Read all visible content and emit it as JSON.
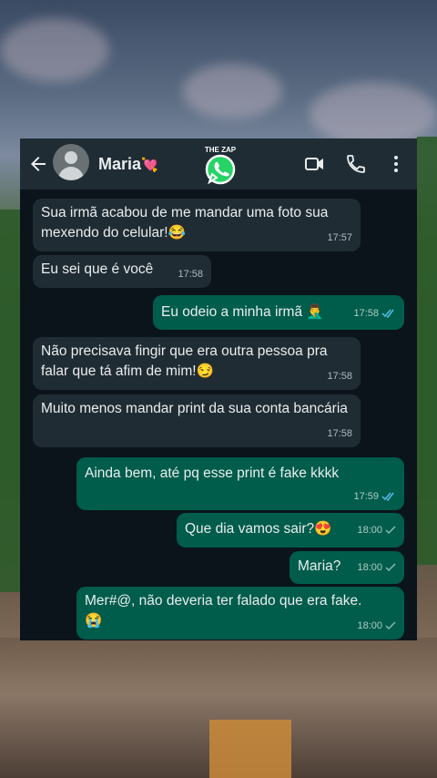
{
  "header": {
    "back_icon": "arrow-left-icon",
    "contact_name": "Maria",
    "heart_emoji": "💘",
    "logo_text": "THE ZAP",
    "icons": [
      "video-call-icon",
      "phone-icon",
      "more-vertical-icon"
    ]
  },
  "messages": [
    {
      "direction": "in",
      "text": "Sua irmã acabou de me mandar uma foto sua mexendo do celular!",
      "emoji": "😂",
      "time": "17:57"
    },
    {
      "direction": "in",
      "text": "Eu sei que é você",
      "time": "17:58"
    },
    {
      "direction": "out",
      "text": "Eu odeio a minha irmã",
      "emoji": "🤦‍♂️",
      "time": "17:58",
      "status": "read"
    },
    {
      "direction": "in",
      "text": "Não precisava fingir que era outra pessoa pra falar que tá afim de mim!",
      "emoji": "😏",
      "time": "17:58"
    },
    {
      "direction": "in",
      "text": "Muito menos mandar print da sua conta bancária",
      "time": "17:58"
    },
    {
      "direction": "out",
      "text": "Ainda bem, até pq esse print é fake kkkk",
      "time": "17:59",
      "status": "read"
    },
    {
      "direction": "out",
      "text": "Que dia vamos sair?",
      "emoji": "😍",
      "time": "18:00",
      "status": "sent"
    },
    {
      "direction": "out",
      "text": "Maria?",
      "time": "18:00",
      "status": "sent"
    },
    {
      "direction": "out",
      "text": "Mer#@, não deveria ter falado que era fake.",
      "emoji": "😭",
      "time": "18:00",
      "status": "sent"
    }
  ],
  "colors": {
    "header_bg": "#1f2c34",
    "chat_bg": "#0b141a",
    "incoming_bubble": "#202c33",
    "outgoing_bubble": "#005c4b",
    "read_tick": "#53bdeb",
    "sent_tick": "#8bb9ad"
  }
}
